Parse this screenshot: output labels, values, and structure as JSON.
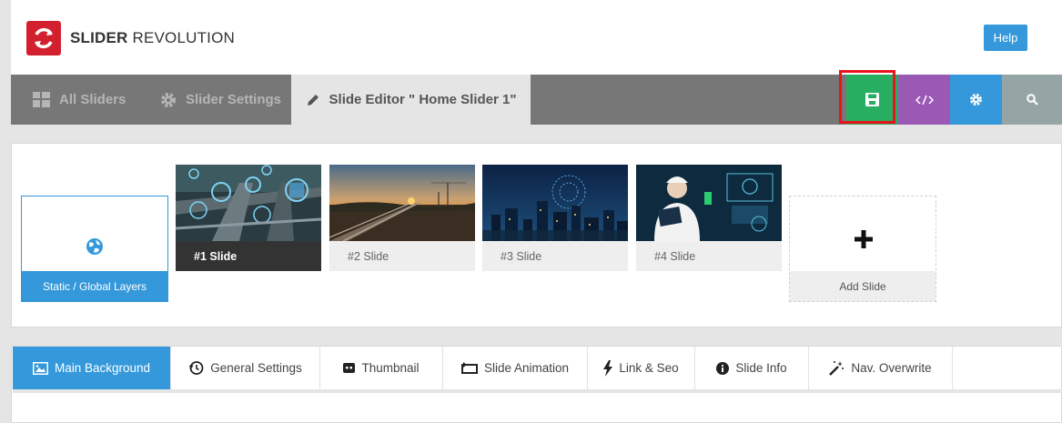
{
  "header": {
    "brand_bold": "SLIDER",
    "brand_light": "REVOLUTION",
    "help_label": "Help"
  },
  "nav": {
    "items": [
      {
        "label": "All Sliders",
        "icon": "grid-icon"
      },
      {
        "label": "Slider Settings",
        "icon": "gear-icon"
      },
      {
        "label": "Slide Editor \" Home Slider 1\"",
        "icon": "pencil-icon"
      }
    ],
    "tools": [
      {
        "name": "save",
        "icon": "floppy-icon",
        "color": "#27ae60"
      },
      {
        "name": "embed",
        "icon": "code-icon",
        "color": "#9b59b6"
      },
      {
        "name": "settings",
        "icon": "gear-icon",
        "color": "#3498db"
      },
      {
        "name": "search",
        "icon": "search-icon",
        "color": "#95a5a6"
      }
    ]
  },
  "slides": {
    "static_label": "Static / Global Layers",
    "items": [
      {
        "label": "#1 Slide",
        "active": true
      },
      {
        "label": "#2 Slide",
        "active": false
      },
      {
        "label": "#3 Slide",
        "active": false
      },
      {
        "label": "#4 Slide",
        "active": false
      }
    ],
    "add_label": "Add Slide"
  },
  "tabs": [
    {
      "label": "Main Background",
      "icon": "image-icon",
      "active": true
    },
    {
      "label": "General Settings",
      "icon": "history-icon"
    },
    {
      "label": "Thumbnail",
      "icon": "thumbnail-icon"
    },
    {
      "label": "Slide Animation",
      "icon": "animation-icon"
    },
    {
      "label": "Link & Seo",
      "icon": "bolt-icon"
    },
    {
      "label": "Slide Info",
      "icon": "info-icon"
    },
    {
      "label": "Nav. Overwrite",
      "icon": "magic-wand-icon"
    }
  ],
  "colors": {
    "accent": "#3498db",
    "brand_red": "#d3202e",
    "save_highlight": "#e8131b"
  }
}
